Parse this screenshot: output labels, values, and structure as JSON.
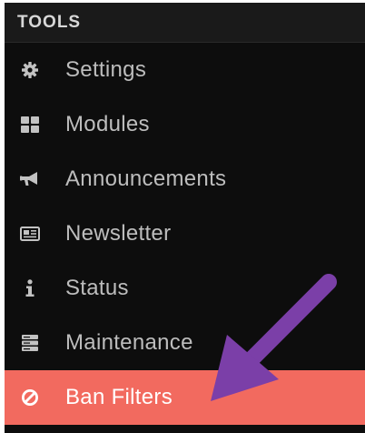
{
  "header": {
    "title": "TOOLS"
  },
  "menu": {
    "items": [
      {
        "label": "Settings",
        "icon": "gear-icon"
      },
      {
        "label": "Modules",
        "icon": "grid-icon"
      },
      {
        "label": "Announcements",
        "icon": "megaphone-icon"
      },
      {
        "label": "Newsletter",
        "icon": "newspaper-icon"
      },
      {
        "label": "Status",
        "icon": "info-icon"
      },
      {
        "label": "Maintenance",
        "icon": "server-icon"
      },
      {
        "label": "Ban Filters",
        "icon": "ban-icon",
        "active": true
      }
    ]
  },
  "colors": {
    "panel_background": "#0d0d0d",
    "active_background": "#f26a5f",
    "annotation_arrow": "#7b3fa8"
  }
}
